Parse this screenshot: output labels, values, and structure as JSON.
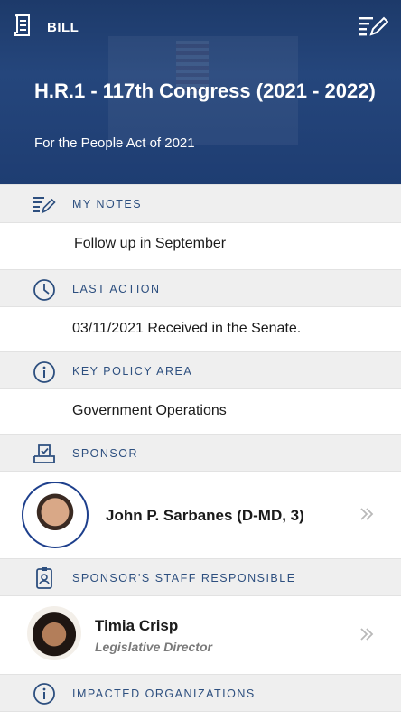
{
  "topbar": {
    "title": "BILL"
  },
  "bill": {
    "title": "H.R.1  - 117th Congress  (2021 - 2022)",
    "subtitle": "For the People Act of 2021"
  },
  "sections": {
    "notes": {
      "label": "MY NOTES",
      "value": "Follow up in September"
    },
    "last_action": {
      "label": "LAST ACTION",
      "value": "03/11/2021 Received in the Senate."
    },
    "policy_area": {
      "label": "KEY POLICY AREA",
      "value": "Government Operations"
    },
    "sponsor": {
      "label": "SPONSOR",
      "name": "John P. Sarbanes (D-MD, 3)"
    },
    "staff": {
      "label": "SPONSOR'S STAFF RESPONSIBLE",
      "name": "Timia Crisp",
      "role": "Legislative Director"
    },
    "organizations": {
      "label": "IMPACTED ORGANIZATIONS"
    }
  },
  "icons": {
    "bill": "document-icon",
    "edit": "edit-notes-icon",
    "notes": "notes-pencil-icon",
    "last_action": "clock-icon",
    "policy": "info-icon",
    "sponsor": "ballot-check-icon",
    "staff": "id-badge-icon",
    "organizations": "info-icon",
    "chevron": "double-chevron-right-icon"
  },
  "colors": {
    "header_bg": "#1e3d72",
    "accent_text": "#2d4f7f",
    "section_bg": "#efefef"
  }
}
